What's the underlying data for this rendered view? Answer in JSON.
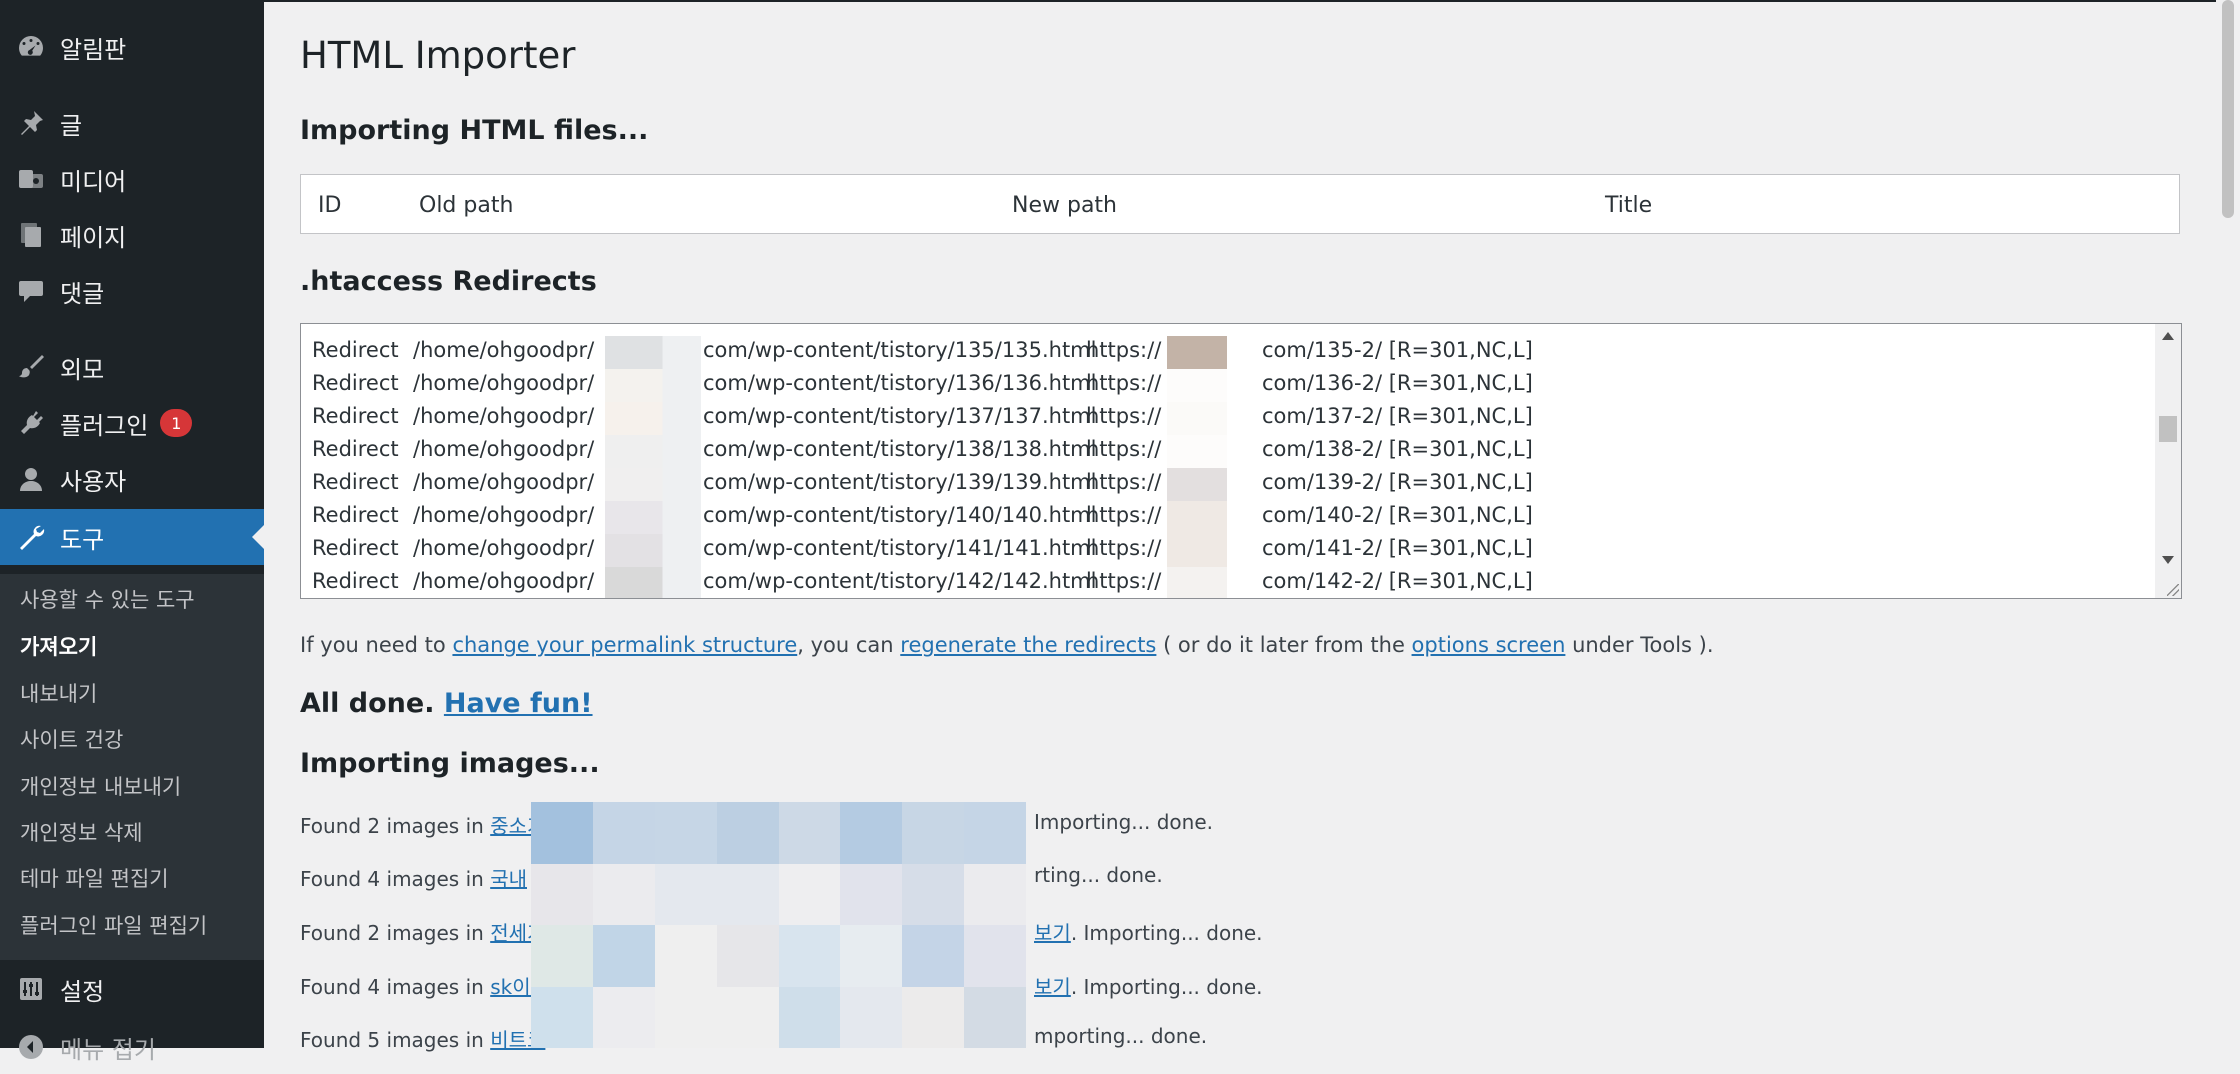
{
  "sidebar": {
    "items": [
      {
        "label": "알림판",
        "icon": "dashboard-icon"
      },
      {
        "label": "글",
        "icon": "pin-icon"
      },
      {
        "label": "미디어",
        "icon": "media-icon"
      },
      {
        "label": "페이지",
        "icon": "page-icon"
      },
      {
        "label": "댓글",
        "icon": "comment-icon"
      },
      {
        "label": "외모",
        "icon": "brush-icon"
      },
      {
        "label": "플러그인",
        "icon": "plugin-icon",
        "badge": "1"
      },
      {
        "label": "사용자",
        "icon": "user-icon"
      },
      {
        "label": "도구",
        "icon": "wrench-icon",
        "active": true
      },
      {
        "label": "설정",
        "icon": "settings-icon"
      },
      {
        "label": "메뉴 접기",
        "icon": "collapse-icon"
      }
    ],
    "submenu": [
      "사용할 수 있는 도구",
      "가져오기",
      "내보내기",
      "사이트 건강",
      "개인정보 내보내기",
      "개인정보 삭제",
      "테마 파일 편집기",
      "플러그인 파일 편집기"
    ],
    "submenu_current": "가져오기"
  },
  "page": {
    "title": "HTML Importer",
    "importing_files": "Importing HTML files...",
    "table_headers": [
      "ID",
      "Old path",
      "New path",
      "Title"
    ],
    "redirects_heading": ".htaccess Redirects",
    "redirects": [
      {
        "cmd": "Redirect",
        "old_pre": "/home/ohgoodpr/",
        "old_post": "com/wp-content/tistory/135/135.html",
        "new_pre": "https://",
        "new_post": "com/135-2/ [R=301,NC,L]"
      },
      {
        "cmd": "Redirect",
        "old_pre": "/home/ohgoodpr/",
        "old_post": "com/wp-content/tistory/136/136.html",
        "new_pre": "https://",
        "new_post": "com/136-2/ [R=301,NC,L]"
      },
      {
        "cmd": "Redirect",
        "old_pre": "/home/ohgoodpr/",
        "old_post": "com/wp-content/tistory/137/137.html",
        "new_pre": "https://",
        "new_post": "com/137-2/ [R=301,NC,L]"
      },
      {
        "cmd": "Redirect",
        "old_pre": "/home/ohgoodpr/",
        "old_post": "com/wp-content/tistory/138/138.html",
        "new_pre": "https://",
        "new_post": "com/138-2/ [R=301,NC,L]"
      },
      {
        "cmd": "Redirect",
        "old_pre": "/home/ohgoodpr/",
        "old_post": "com/wp-content/tistory/139/139.html",
        "new_pre": "https://",
        "new_post": "com/139-2/ [R=301,NC,L]"
      },
      {
        "cmd": "Redirect",
        "old_pre": "/home/ohgoodpr/",
        "old_post": "com/wp-content/tistory/140/140.html",
        "new_pre": "https://",
        "new_post": "com/140-2/ [R=301,NC,L]"
      },
      {
        "cmd": "Redirect",
        "old_pre": "/home/ohgoodpr/",
        "old_post": "com/wp-content/tistory/141/141.html",
        "new_pre": "https://",
        "new_post": "com/141-2/ [R=301,NC,L]"
      },
      {
        "cmd": "Redirect",
        "old_pre": "/home/ohgoodpr/",
        "old_post": "com/wp-content/tistory/142/142.html",
        "new_pre": "https://",
        "new_post": "com/142-2/ [R=301,NC,L]"
      }
    ],
    "permalink_note": {
      "t1": "If you need to ",
      "link1": "change your permalink structure",
      "t2": ", you can ",
      "link2": "regenerate the redirects",
      "t3": " ( or do it later from the ",
      "link3": "options screen",
      "t4": " under Tools )."
    },
    "all_done": "All done.",
    "have_fun": "Have fun!",
    "importing_images": "Importing images...",
    "image_lines": [
      {
        "pre": "Found 2 images in ",
        "link": "중소기",
        "mid": "",
        "post": " Importing... done."
      },
      {
        "pre": "Found 4 images in ",
        "link": "국내 ",
        "mid": "",
        "post": "rting... done."
      },
      {
        "pre": "Found 2 images in ",
        "link": "전세기",
        "mid": "보기",
        "post": ". Importing... done."
      },
      {
        "pre": "Found 4 images in ",
        "link": "sk이노",
        "mid": "보기",
        "post": ". Importing... done."
      },
      {
        "pre": "Found 5 images in ",
        "link": "비트코",
        "mid": "",
        "post": "mporting... done."
      }
    ]
  },
  "colors": {
    "sidebar_bg": "#1d2327",
    "active_bg": "#2271b1",
    "link": "#2271b1",
    "badge": "#d63638"
  }
}
